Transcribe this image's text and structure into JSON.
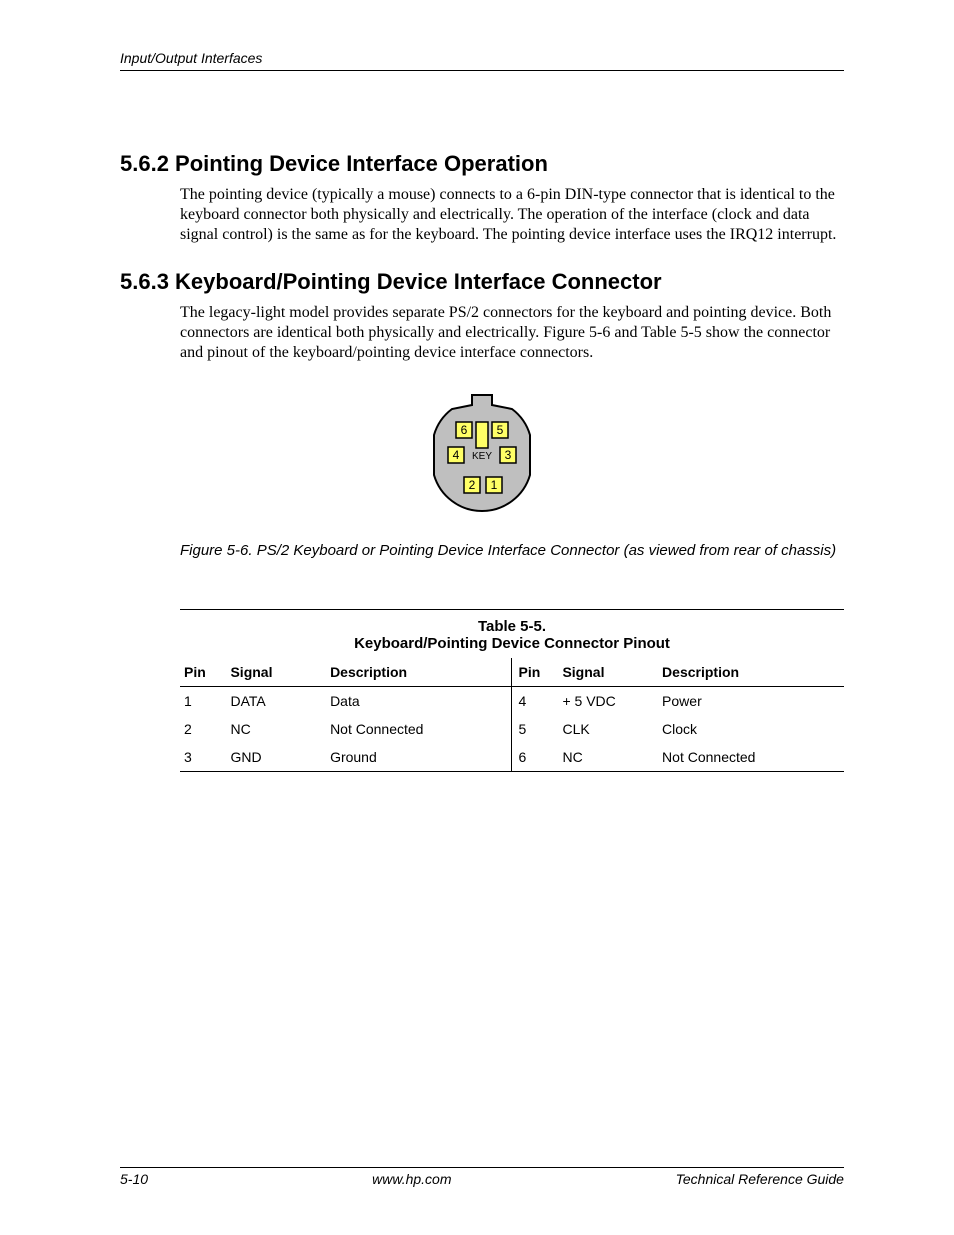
{
  "header": {
    "running_title": "Input/Output Interfaces"
  },
  "sections": {
    "s1": {
      "heading": "5.6.2 Pointing Device Interface Operation",
      "paragraph": "The pointing device  (typically a mouse) connects to a 6-pin DIN-type connector that is identical to the keyboard connector both physically and electrically. The operation of the interface (clock and data signal control) is the same as for the keyboard. The pointing device interface uses the IRQ12 interrupt."
    },
    "s2": {
      "heading": "5.6.3 Keyboard/Pointing Device Interface Connector",
      "paragraph": "The legacy-light model provides separate PS/2 connectors for the keyboard and pointing device. Both connectors are identical both physically and electrically. Figure 5-6 and Table 5-5 show the connector and pinout of the keyboard/pointing device interface connectors."
    }
  },
  "figure": {
    "pin_labels": {
      "p1": "1",
      "p2": "2",
      "p3": "3",
      "p4": "4",
      "p5": "5",
      "p6": "6"
    },
    "key_label": "KEY",
    "caption": "Figure 5-6. PS/2 Keyboard or Pointing Device Interface Connector (as viewed from rear of chassis)"
  },
  "table": {
    "title_line1": "Table 5-5.",
    "title_line2": "Keyboard/Pointing Device Connector Pinout",
    "headers": {
      "pin": "Pin",
      "signal": "Signal",
      "description": "Description"
    },
    "rows": [
      {
        "left": {
          "pin": "1",
          "signal": "DATA",
          "desc": "Data"
        },
        "right": {
          "pin": "4",
          "signal": "+ 5 VDC",
          "desc": "Power"
        }
      },
      {
        "left": {
          "pin": "2",
          "signal": "NC",
          "desc": "Not Connected"
        },
        "right": {
          "pin": "5",
          "signal": "CLK",
          "desc": "Clock"
        }
      },
      {
        "left": {
          "pin": "3",
          "signal": "GND",
          "desc": "Ground"
        },
        "right": {
          "pin": "6",
          "signal": "NC",
          "desc": "Not Connected"
        }
      }
    ]
  },
  "footer": {
    "page_num": "5-10",
    "center": "www.hp.com",
    "right": "Technical Reference Guide"
  }
}
